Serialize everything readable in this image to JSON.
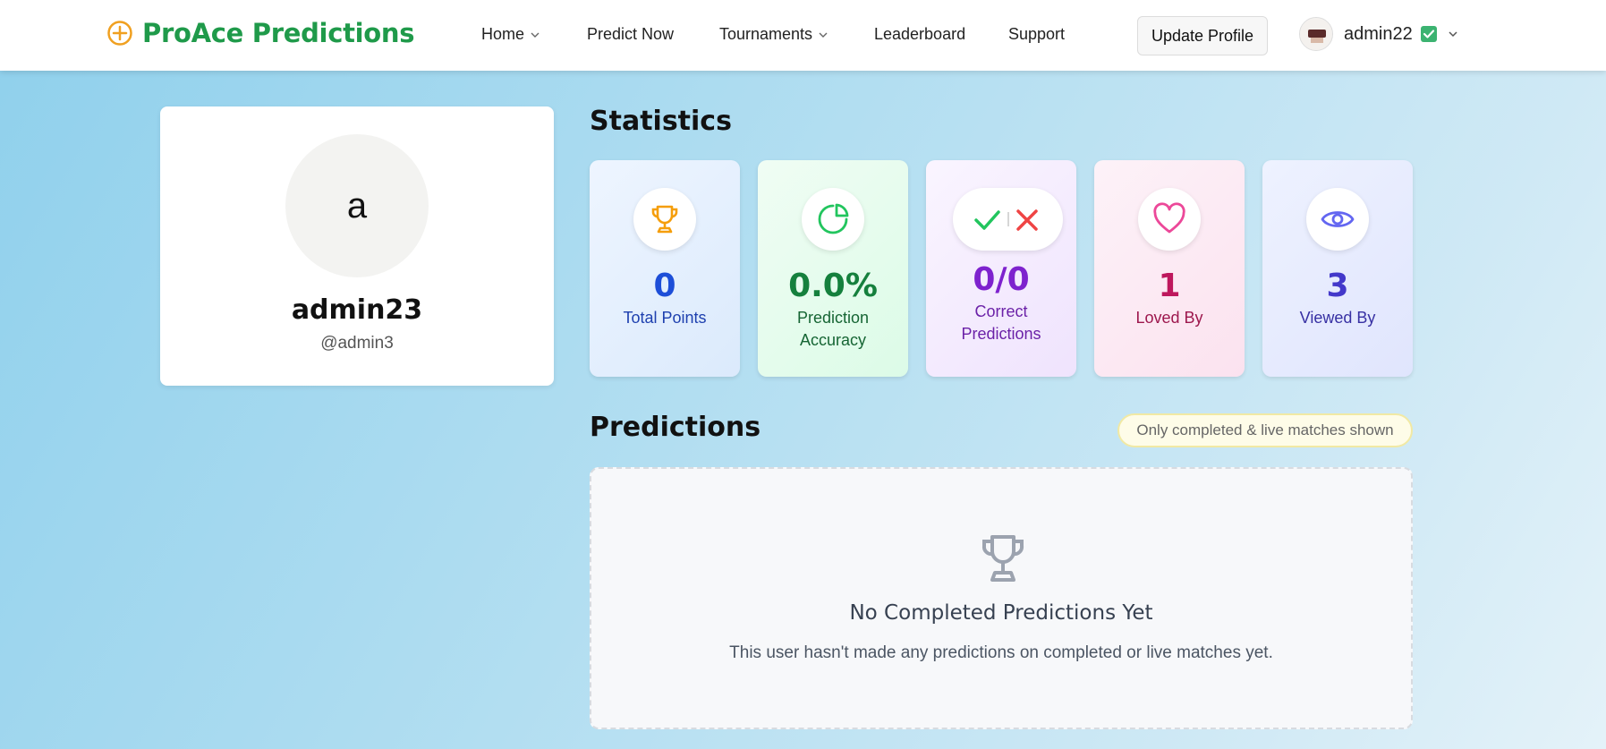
{
  "navbar": {
    "brand": "ProAce Predictions",
    "items": [
      {
        "label": "Home",
        "has_dropdown": true
      },
      {
        "label": "Predict Now",
        "has_dropdown": false
      },
      {
        "label": "Tournaments",
        "has_dropdown": true
      },
      {
        "label": "Leaderboard",
        "has_dropdown": false
      },
      {
        "label": "Support",
        "has_dropdown": false
      }
    ],
    "update_profile_label": "Update Profile",
    "user": {
      "name": "admin22",
      "verified": true
    }
  },
  "profile": {
    "avatar_initial": "a",
    "display_name": "admin23",
    "handle": "@admin3"
  },
  "statistics": {
    "title": "Statistics",
    "cards": [
      {
        "icon": "trophy-icon",
        "value": "0",
        "label": "Total Points",
        "color": "#1d4ed8",
        "icon_color": "#f59e0b"
      },
      {
        "icon": "pie-chart-icon",
        "value": "0.0%",
        "label": "Prediction Accuracy",
        "color": "#15803d",
        "icon_color": "#22c55e"
      },
      {
        "icon": "check-cross-icon",
        "value": "0/0",
        "label": "Correct Predictions",
        "color": "#7e22ce",
        "icon_color": "#22c55e"
      },
      {
        "icon": "heart-icon",
        "value": "1",
        "label": "Loved By",
        "color": "#be185d",
        "icon_color": "#ec4899"
      },
      {
        "icon": "eye-icon",
        "value": "3",
        "label": "Viewed By",
        "color": "#4338ca",
        "icon_color": "#6366f1"
      }
    ]
  },
  "predictions": {
    "title": "Predictions",
    "note": "Only completed & live matches shown",
    "empty_title": "No Completed Predictions Yet",
    "empty_text": "This user hasn't made any predictions on completed or live matches yet."
  },
  "colors": {
    "brand": "#1f9a4a",
    "brand_icon": "#f0a020"
  }
}
